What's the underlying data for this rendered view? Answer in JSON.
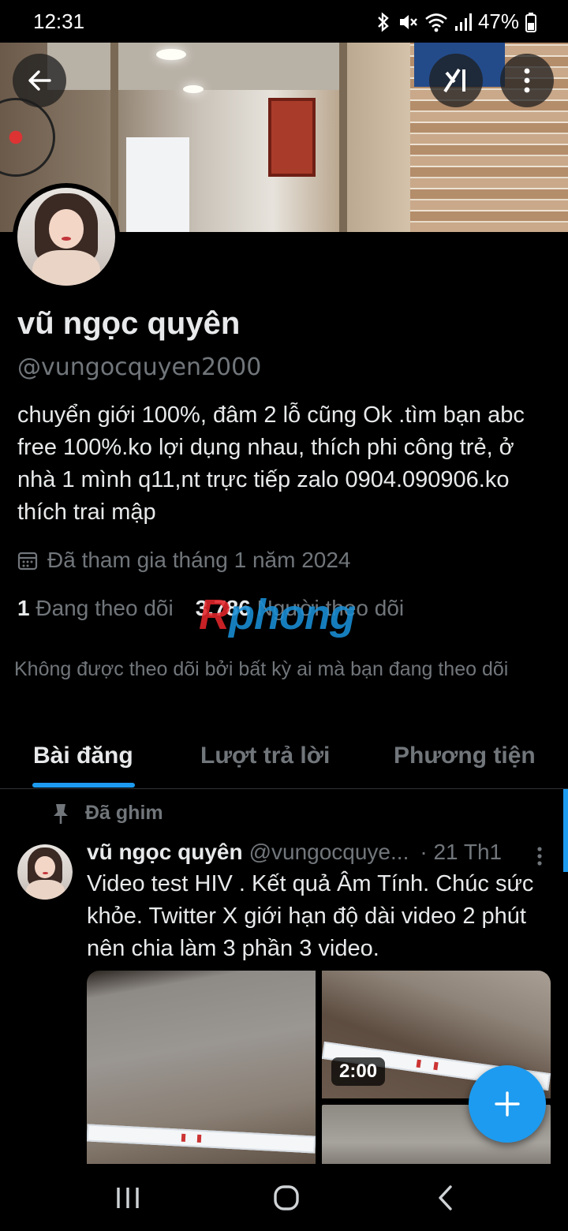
{
  "status_bar": {
    "time": "12:31",
    "battery": "47%",
    "icons": [
      "bluetooth-icon",
      "mute-icon",
      "wifi-icon",
      "signal-icon",
      "battery-icon"
    ]
  },
  "header": {
    "back_icon": "arrow-left-icon",
    "grok_icon": "grok-icon",
    "more_icon": "more-vertical-icon"
  },
  "profile": {
    "name": "vũ ngọc quyên",
    "handle": "@vungocquyen2000",
    "bio": "chuyển giới 100%, đâm 2 lỗ cũng Ok .tìm bạn abc free 100%.ko lợi dụng nhau, thích phi công trẻ, ở nhà 1 mình q11,nt trực tiếp zalo 0904.090906.ko thích trai mập",
    "joined": "Đã tham gia tháng 1 năm 2024",
    "following_count": "1",
    "following_label": "Đang theo dõi",
    "followers_count": "3.786",
    "followers_label": "Người theo dõi",
    "not_followed_note": "Không được theo dõi bởi bất kỳ ai mà bạn đang theo dõi"
  },
  "watermark": {
    "first": "R",
    "rest": "phong"
  },
  "tabs": [
    {
      "label": "Bài đăng",
      "active": true
    },
    {
      "label": "Lượt trả lời",
      "active": false
    },
    {
      "label": "Phương tiện",
      "active": false
    }
  ],
  "post": {
    "pinned_label": "Đã ghim",
    "author_name": "vũ ngọc quyên",
    "author_handle": "@vungocquye...",
    "date": "· 21 Th1",
    "text": "Video test HIV . Kết quả Âm Tính. Chúc sức khỏe. Twitter X giới hạn độ dài video 2 phút nên chia làm 3 phần 3 video.",
    "video_duration": "2:00"
  },
  "colors": {
    "accent": "#1d9bf0",
    "background": "#000000",
    "text_primary": "#e7e9ea",
    "text_secondary": "#71767b",
    "watermark_red": "#e3262b",
    "watermark_blue": "#1a8fd6"
  }
}
